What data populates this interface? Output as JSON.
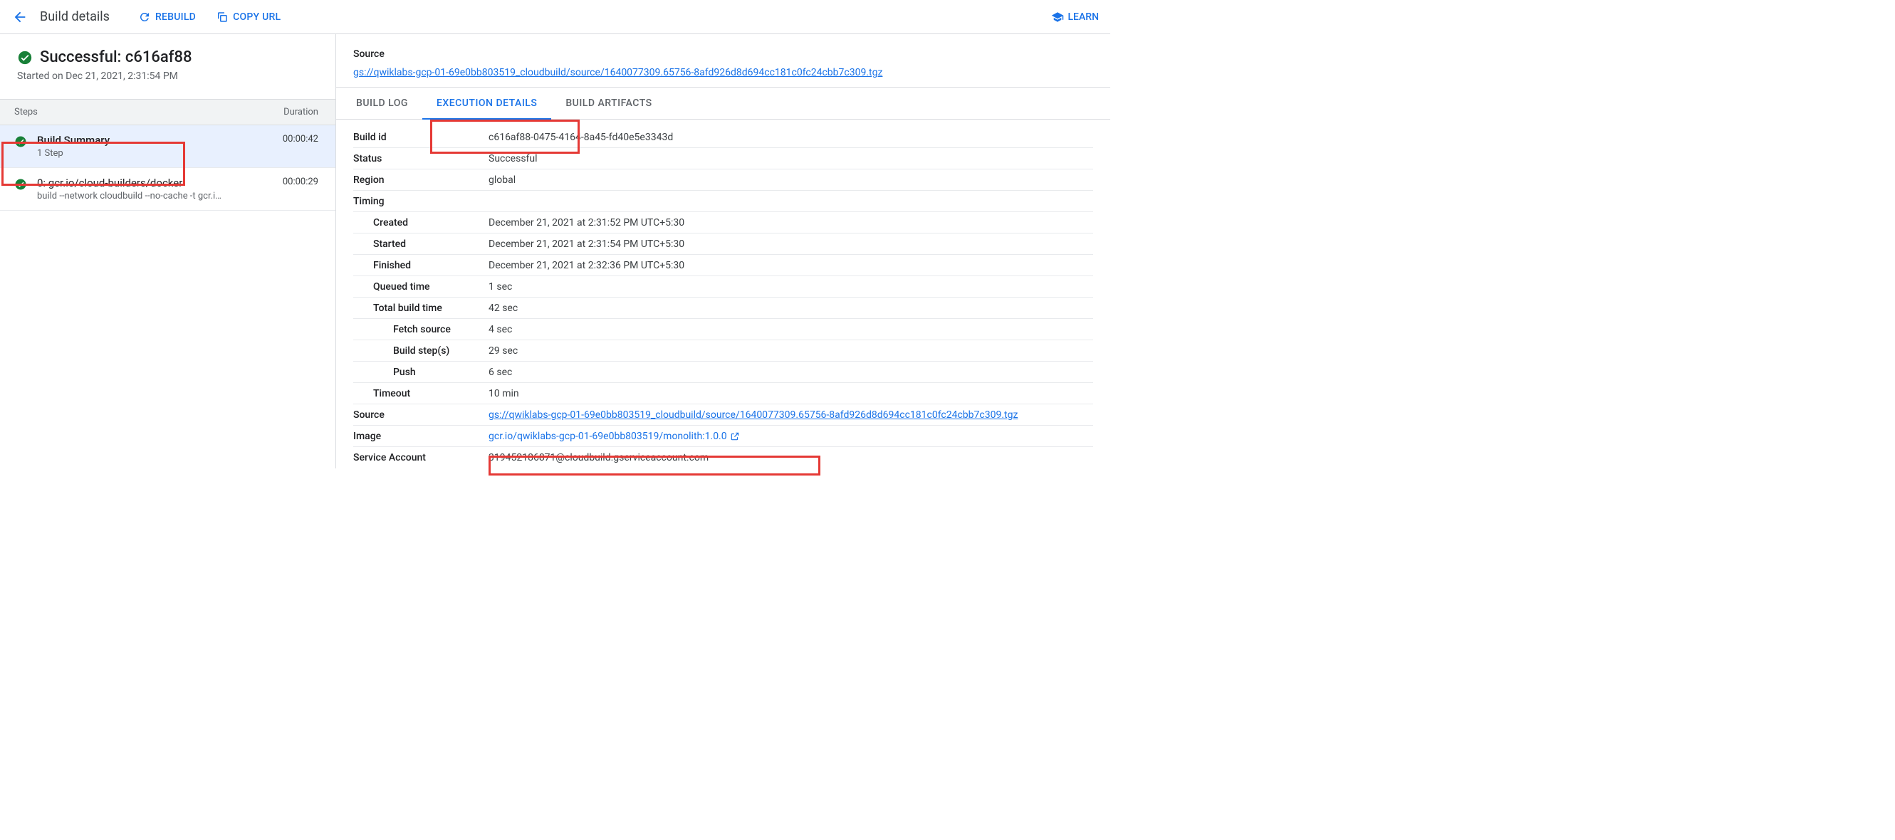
{
  "topbar": {
    "title": "Build details",
    "rebuild": "REBUILD",
    "copy_url": "COPY URL",
    "learn": "LEARN"
  },
  "summary": {
    "heading": "Successful: c616af88",
    "started": "Started on Dec 21, 2021, 2:31:54 PM"
  },
  "steps_header": {
    "steps": "Steps",
    "duration": "Duration"
  },
  "steps": [
    {
      "title": "Build Summary",
      "subtitle": "1 Step",
      "duration": "00:00:42"
    },
    {
      "title": "0: gcr.io/cloud-builders/docker",
      "subtitle": "build --network cloudbuild --no-cache -t gcr.i…",
      "duration": "00:00:29"
    }
  ],
  "source": {
    "label": "Source",
    "link": "gs://qwiklabs-gcp-01-69e0bb803519_cloudbuild/source/1640077309.65756-8afd926d8d694cc181c0fc24cbb7c309.tgz"
  },
  "tabs": {
    "build_log": "BUILD LOG",
    "execution_details": "EXECUTION DETAILS",
    "build_artifacts": "BUILD ARTIFACTS"
  },
  "details": {
    "build_id": {
      "label": "Build id",
      "value": "c616af88-0475-4164-8a45-fd40e5e3343d"
    },
    "status": {
      "label": "Status",
      "value": "Successful"
    },
    "region": {
      "label": "Region",
      "value": "global"
    },
    "timing": {
      "label": "Timing"
    },
    "created": {
      "label": "Created",
      "value": "December 21, 2021 at 2:31:52 PM UTC+5:30"
    },
    "started": {
      "label": "Started",
      "value": "December 21, 2021 at 2:31:54 PM UTC+5:30"
    },
    "finished": {
      "label": "Finished",
      "value": "December 21, 2021 at 2:32:36 PM UTC+5:30"
    },
    "queued": {
      "label": "Queued time",
      "value": "1 sec"
    },
    "total": {
      "label": "Total build time",
      "value": "42 sec"
    },
    "fetch": {
      "label": "Fetch source",
      "value": "4 sec"
    },
    "build_steps": {
      "label": "Build step(s)",
      "value": "29 sec"
    },
    "push": {
      "label": "Push",
      "value": "6 sec"
    },
    "timeout": {
      "label": "Timeout",
      "value": "10 min"
    },
    "source": {
      "label": "Source",
      "value": "gs://qwiklabs-gcp-01-69e0bb803519_cloudbuild/source/1640077309.65756-8afd926d8d694cc181c0fc24cbb7c309.tgz"
    },
    "image": {
      "label": "Image",
      "value": "gcr.io/qwiklabs-gcp-01-69e0bb803519/monolith:1.0.0"
    },
    "service_account": {
      "label": "Service Account",
      "value": "319452186871@cloudbuild.gserviceaccount.com"
    }
  }
}
